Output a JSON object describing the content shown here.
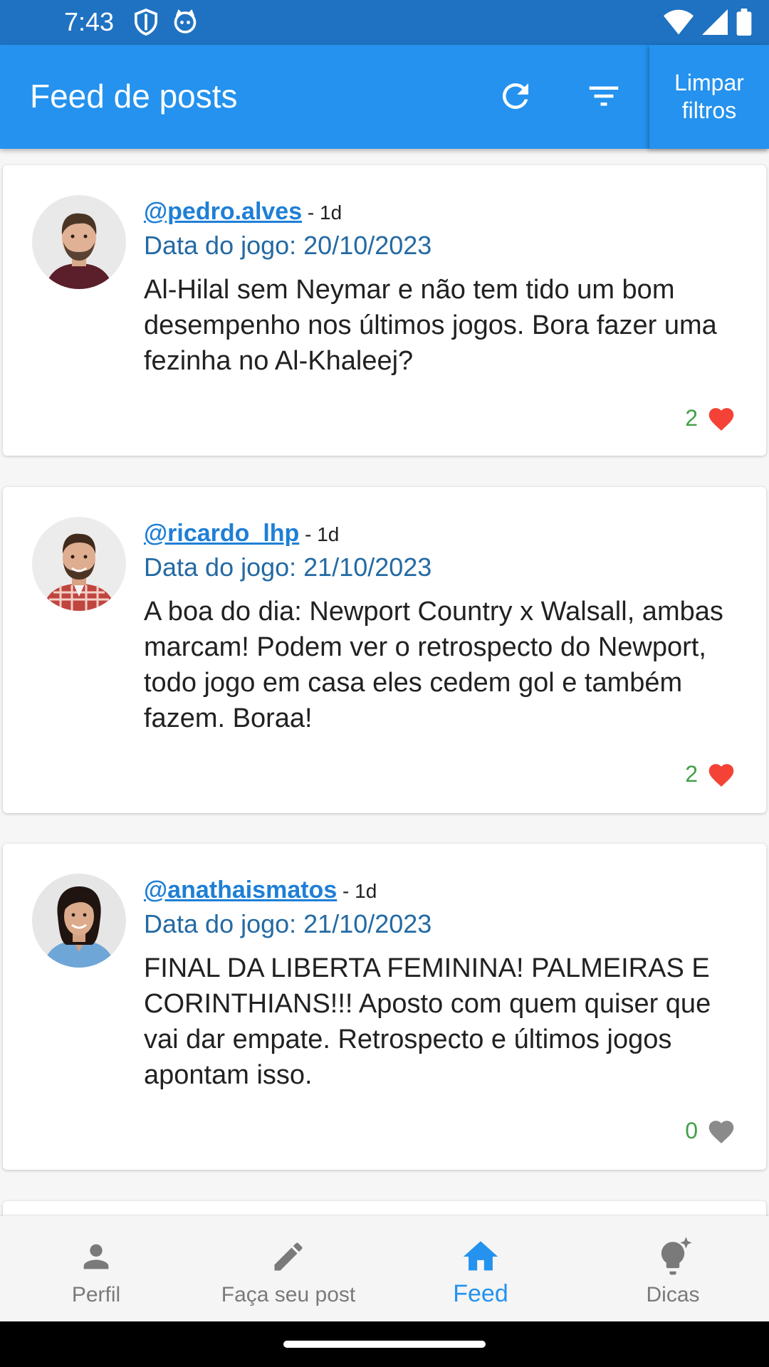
{
  "status_bar": {
    "time": "7:43"
  },
  "app_bar": {
    "title": "Feed de posts",
    "clear_filters_line1": "Limpar",
    "clear_filters_line2": "filtros"
  },
  "posts": [
    {
      "username": "@pedro.alves",
      "age": " - 1d",
      "game_date": "Data do jogo: 20/10/2023",
      "text": "Al-Hilal sem Neymar e não tem tido um bom desempenho nos últimos jogos. Bora fazer uma fezinha no Al-Khaleej?",
      "likes": "2",
      "liked": true
    },
    {
      "username": "@ricardo_lhp",
      "age": " - 1d",
      "game_date": "Data do jogo: 21/10/2023",
      "text": "A boa do dia: Newport Country x Walsall, ambas marcam! Podem ver o retrospecto do Newport, todo jogo em casa eles cedem gol e também fazem. Boraa!",
      "likes": "2",
      "liked": true
    },
    {
      "username": "@anathaismatos",
      "age": " - 1d",
      "game_date": "Data do jogo: 21/10/2023",
      "text": "FINAL DA LIBERTA FEMININA! PALMEIRAS E CORINTHIANS!!! Aposto com quem quiser que vai dar empate. Retrospecto e últimos jogos apontam isso.",
      "likes": "0",
      "liked": false
    }
  ],
  "bottom_nav": {
    "items": [
      {
        "label": "Perfil",
        "icon": "person-icon"
      },
      {
        "label": "Faça seu post",
        "icon": "pencil-icon"
      },
      {
        "label": "Feed",
        "icon": "home-icon"
      },
      {
        "label": "Dicas",
        "icon": "lightbulb-icon"
      }
    ],
    "active": "Feed"
  },
  "colors": {
    "status_bar": "#1f72c1",
    "app_bar": "#2492ee",
    "username": "#1e7fd6",
    "game_date": "#246aa3",
    "like_count": "#43a047",
    "heart_liked": "#f44336",
    "heart_unliked": "#8a8a8a"
  }
}
